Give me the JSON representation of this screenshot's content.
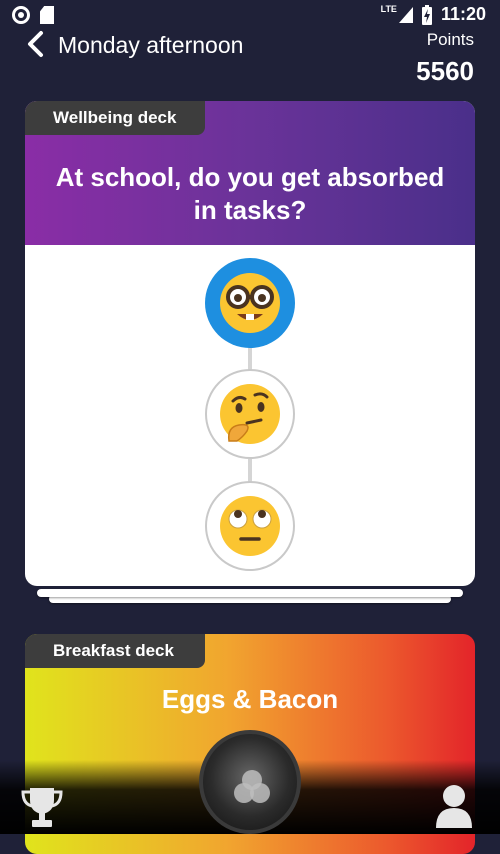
{
  "status_bar": {
    "network": "LTE",
    "time": "11:20"
  },
  "header": {
    "title": "Monday afternoon",
    "points_label": "Points",
    "points_value": "5560"
  },
  "wellbeing_card": {
    "deck_label": "Wellbeing deck",
    "question": "At school, do you get absorbed in tasks?",
    "options": [
      {
        "icon": "nerd-face-emoji",
        "emoji": "🤓",
        "selected": true
      },
      {
        "icon": "thinking-face-emoji",
        "emoji": "🤔",
        "selected": false
      },
      {
        "icon": "eye-roll-face-emoji",
        "emoji": "🙄",
        "selected": false
      }
    ],
    "colors": {
      "gradient_start": "#8a2da6",
      "gradient_end": "#4a2f8a",
      "selected": "#1e8fe0"
    }
  },
  "breakfast_card": {
    "deck_label": "Breakfast deck",
    "title": "Eggs & Bacon",
    "colors": {
      "gradient_start": "#e0e41c",
      "gradient_end": "#e3242a"
    }
  },
  "bottom_nav": {
    "left_icon": "trophy-icon",
    "center_icon": "decks-icon",
    "right_icon": "profile-icon"
  }
}
